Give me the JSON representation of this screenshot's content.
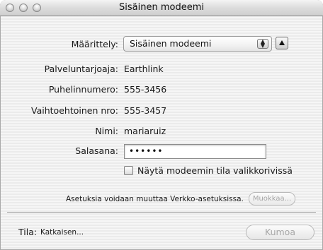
{
  "window": {
    "title": "Sisäinen modeemi"
  },
  "configuration": {
    "label": "Määrittely:",
    "selected": "Sisäinen modeemi"
  },
  "fields": [
    {
      "label": "Palveluntarjoaja:",
      "value": "Earthlink"
    },
    {
      "label": "Puhelinnumero:",
      "value": "555-3456"
    },
    {
      "label": "Vaihtoehtoinen nro:",
      "value": "555-3457"
    },
    {
      "label": "Nimi:",
      "value": "mariaruiz"
    }
  ],
  "password": {
    "label": "Salasana:",
    "value": "••••••"
  },
  "checkbox": {
    "label": "Näytä modeemin tila valikkorivissä",
    "checked": false
  },
  "info": {
    "text": "Asetuksia voidaan muuttaa Verkko-asetuksissa.",
    "edit_button": "Muokkaa..."
  },
  "status": {
    "label": "Tila:",
    "value": "Katkaisen..."
  },
  "cancel_button": "Kumoa",
  "icons": {
    "popup_arrows": "up-down-arrows-icon",
    "eject": "eject-icon"
  }
}
